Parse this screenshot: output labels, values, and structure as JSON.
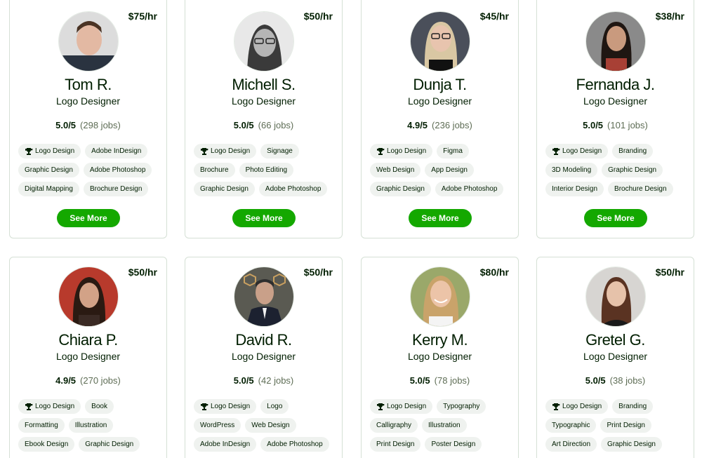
{
  "accent_color": "#14a800",
  "cards": [
    {
      "rate": "$75/hr",
      "name": "Tom R.",
      "title": "Logo Designer",
      "score": "5.0/5",
      "jobs": "(298 jobs)",
      "skills": [
        "Logo Design",
        "Adobe InDesign",
        "Graphic Design",
        "Adobe Photoshop",
        "Digital Mapping",
        "Brochure Design"
      ],
      "button": "See More"
    },
    {
      "rate": "$50/hr",
      "name": "Michell S.",
      "title": "Logo Designer",
      "score": "5.0/5",
      "jobs": "(66 jobs)",
      "skills": [
        "Logo Design",
        "Signage",
        "Brochure",
        "Photo Editing",
        "Graphic Design",
        "Adobe Photoshop"
      ],
      "button": "See More"
    },
    {
      "rate": "$45/hr",
      "name": "Dunja T.",
      "title": "Logo Designer",
      "score": "4.9/5",
      "jobs": "(236 jobs)",
      "skills": [
        "Logo Design",
        "Figma",
        "Web Design",
        "App Design",
        "Graphic Design",
        "Adobe Photoshop"
      ],
      "button": "See More"
    },
    {
      "rate": "$38/hr",
      "name": "Fernanda J.",
      "title": "Logo Designer",
      "score": "5.0/5",
      "jobs": "(101 jobs)",
      "skills": [
        "Logo Design",
        "Branding",
        "3D Modeling",
        "Graphic Design",
        "Interior Design",
        "Brochure Design"
      ],
      "button": "See More"
    },
    {
      "rate": "$50/hr",
      "name": "Chiara P.",
      "title": "Logo Designer",
      "score": "4.9/5",
      "jobs": "(270 jobs)",
      "skills": [
        "Logo Design",
        "Book",
        "Formatting",
        "Illustration",
        "Ebook Design",
        "Graphic Design"
      ],
      "button": ""
    },
    {
      "rate": "$50/hr",
      "name": "David R.",
      "title": "Logo Designer",
      "score": "5.0/5",
      "jobs": "(42 jobs)",
      "skills": [
        "Logo Design",
        "Logo",
        "WordPress",
        "Web Design",
        "Adobe InDesign",
        "Adobe Photoshop"
      ],
      "button": ""
    },
    {
      "rate": "$80/hr",
      "name": "Kerry M.",
      "title": "Logo Designer",
      "score": "5.0/5",
      "jobs": "(78 jobs)",
      "skills": [
        "Logo Design",
        "Typography",
        "Calligraphy",
        "Illustration",
        "Print Design",
        "Poster Design"
      ],
      "button": ""
    },
    {
      "rate": "$50/hr",
      "name": "Gretel G.",
      "title": "Logo Designer",
      "score": "5.0/5",
      "jobs": "(38 jobs)",
      "skills": [
        "Logo Design",
        "Branding",
        "Typographic",
        "Print Design",
        "Art Direction",
        "Graphic Design"
      ],
      "button": ""
    }
  ]
}
